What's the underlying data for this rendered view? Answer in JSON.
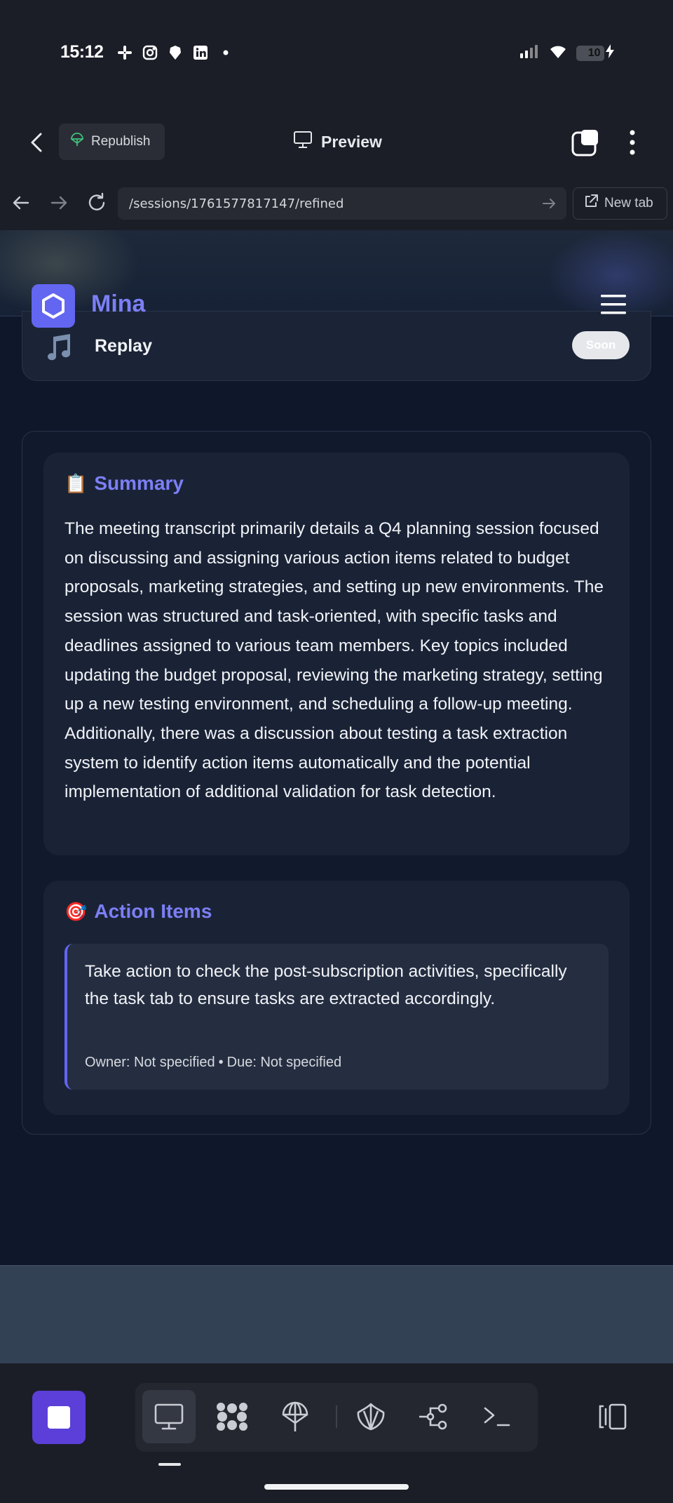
{
  "status_bar": {
    "time": "15:12",
    "battery": "10",
    "battery_level": 0.1,
    "notification_icons": [
      "slack-icon",
      "instagram-icon",
      "brave-icon",
      "linkedin-icon",
      "dot-icon"
    ],
    "right_icons": [
      "signal-icon",
      "wifi-icon",
      "battery-icon",
      "charging-icon"
    ]
  },
  "app_header": {
    "republish_label": "Republish",
    "preview_label": "Preview"
  },
  "url_bar": {
    "url": "/sessions/1761577817147/refined",
    "new_tab_label": "New tab"
  },
  "webpage": {
    "brand": "Mina",
    "replay": {
      "label": "Replay",
      "badge": "Soon",
      "icon": "music-note-icon"
    },
    "summary": {
      "emoji": "📋",
      "title": "Summary",
      "text": "The meeting transcript primarily details a Q4 planning session focused on discussing and assigning various action items related to budget proposals, marketing strategies, and setting up new environments. The session was structured and task-oriented, with specific tasks and deadlines assigned to various team members. Key topics included updating the budget proposal, reviewing the marketing strategy, setting up a new testing environment, and scheduling a follow-up meeting. Additionally, there was a discussion about testing a task extraction system to identify action items automatically and the potential implementation of additional validation for task detection."
    },
    "action_items": {
      "emoji": "🎯",
      "title": "Action Items",
      "items": [
        {
          "text": "Take action to check the post-subscription activities, specifically the task tab to ensure tasks are extracted accordingly.",
          "owner": "Owner: Not specified",
          "separator": "•",
          "due": "Due: Not specified"
        }
      ]
    }
  },
  "toolbar": {
    "tools": [
      "desktop-icon",
      "apps-icon",
      "deploy-icon",
      "shell-icon",
      "workflow-icon",
      "terminal-icon"
    ],
    "active_tool": "desktop-icon"
  },
  "colors": {
    "accent": "#6366f1",
    "brand_text": "#7c7ff5",
    "page_bg": "#0f172a",
    "stop_button": "#5b3fd8"
  }
}
